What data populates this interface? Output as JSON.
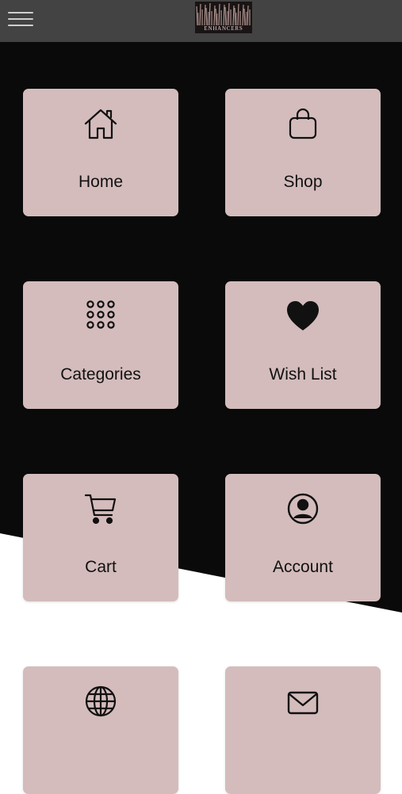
{
  "header": {
    "menu_icon": "hamburger-menu-icon",
    "logo_text": "ENHANCERS",
    "logo_colors": {
      "background": "#1a1414",
      "accent": "#e8c9c4"
    }
  },
  "theme": {
    "header_bg": "#434343",
    "page_dark": "#0a0a0a",
    "page_light": "#ffffff",
    "tile_bg": "#d4bcbc",
    "text": "#111111"
  },
  "tiles": [
    {
      "label": "Home",
      "icon": "home-icon"
    },
    {
      "label": "Shop",
      "icon": "shopping-bag-icon"
    },
    {
      "label": "Categories",
      "icon": "grid-dots-icon"
    },
    {
      "label": "Wish List",
      "icon": "heart-icon"
    },
    {
      "label": "Cart",
      "icon": "cart-icon"
    },
    {
      "label": "Account",
      "icon": "account-icon"
    },
    {
      "label": "",
      "icon": "globe-icon"
    },
    {
      "label": "",
      "icon": "mail-icon"
    }
  ]
}
